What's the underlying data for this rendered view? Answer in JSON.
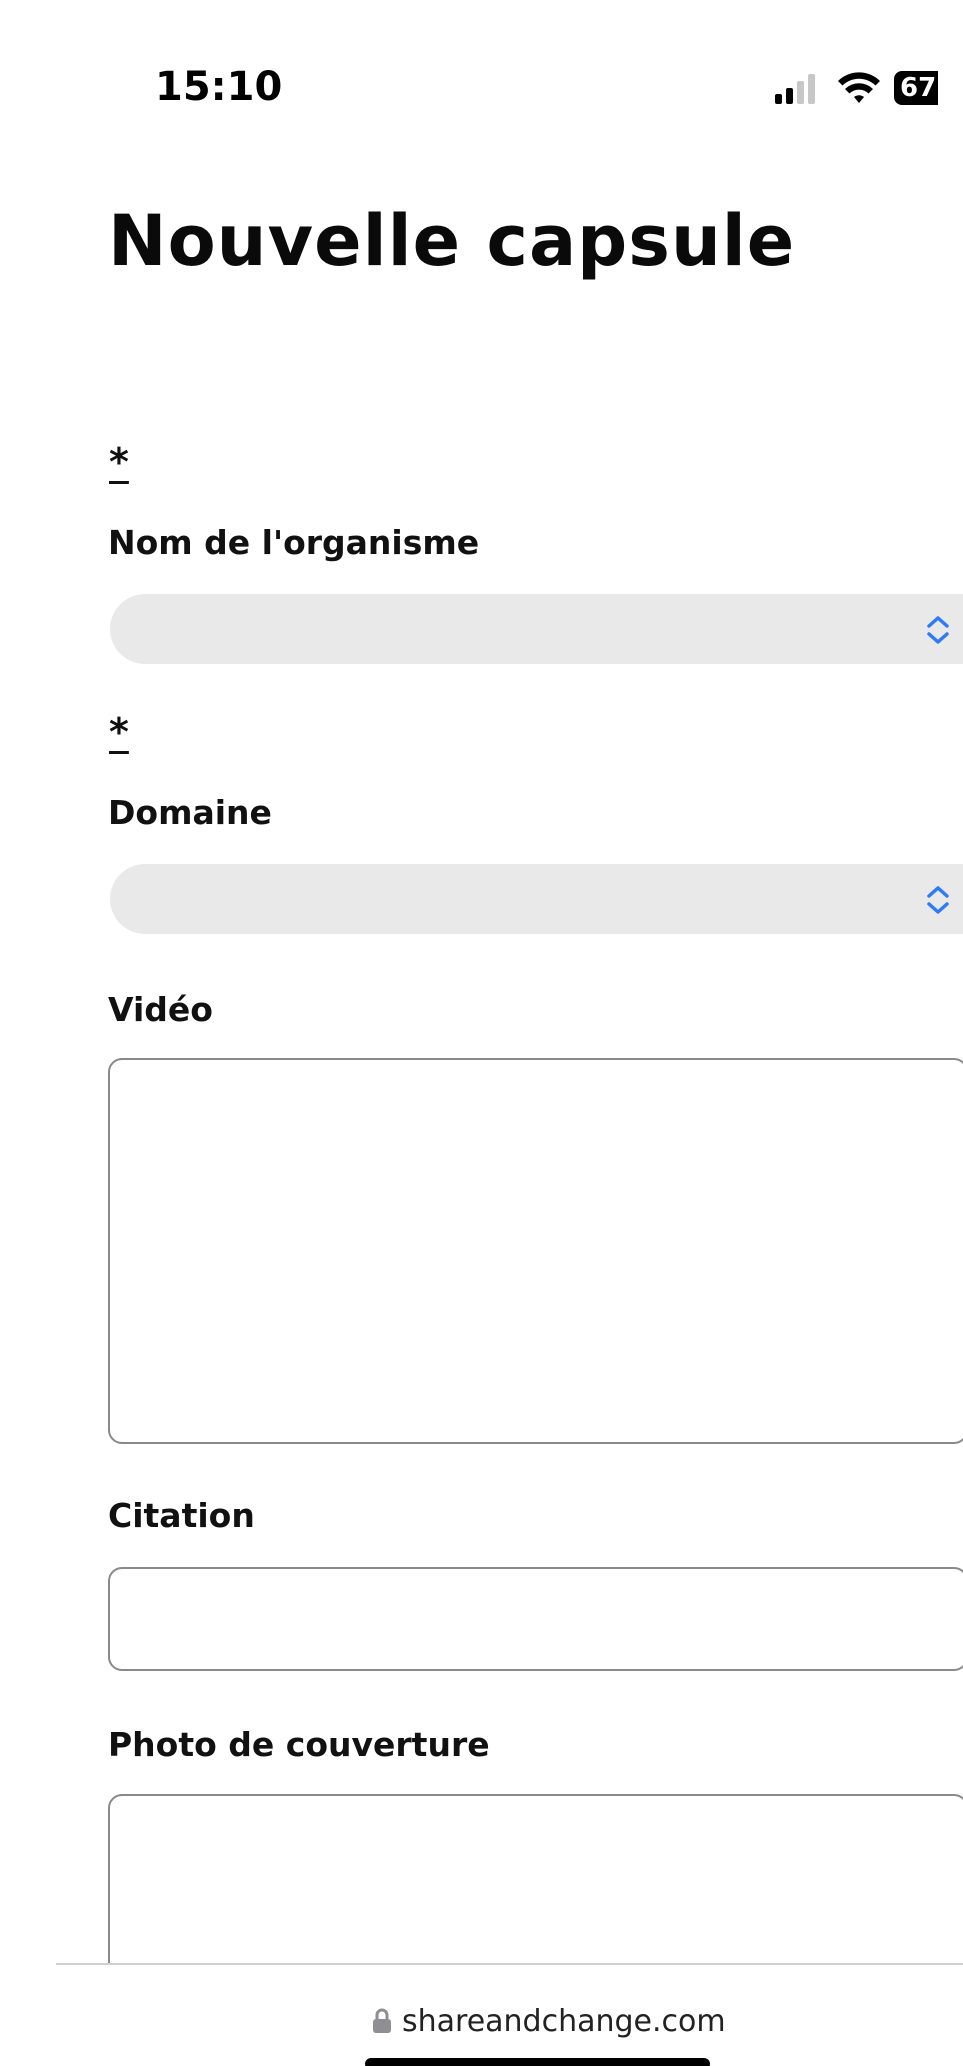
{
  "status_bar": {
    "time": "15:10",
    "battery_level": "67",
    "icons": [
      "signal-icon",
      "wifi-icon",
      "battery-icon"
    ]
  },
  "page": {
    "title": "Nouvelle capsule"
  },
  "form": {
    "required_marker": "*",
    "organisme": {
      "label": "Nom de l'organisme",
      "value": ""
    },
    "domaine": {
      "label": "Domaine",
      "value": ""
    },
    "video": {
      "label": "Vidéo"
    },
    "citation": {
      "label": "Citation"
    },
    "photo": {
      "label": "Photo de couverture"
    }
  },
  "browser": {
    "url": "shareandchange.com",
    "icon": "lock-icon"
  },
  "colors": {
    "select_bg": "#e9e9ea",
    "chevron_blue": "#2f7bf6",
    "textbox_border": "#8a8a8a"
  }
}
